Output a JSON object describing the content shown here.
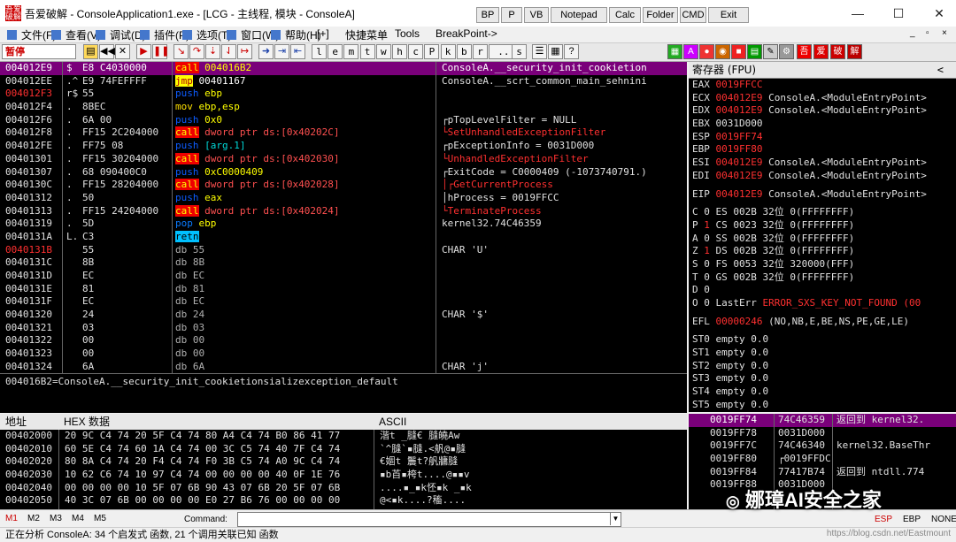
{
  "window": {
    "app_icon": "吾爱\n破解",
    "title": "吾爱破解 - ConsoleApplication1.exe - [LCG - 主线程, 模块 - ConsoleA]",
    "tool_buttons": [
      "BP",
      "P",
      "VB",
      "Notepad",
      "Calc",
      "Folder",
      "CMD",
      "Exit"
    ],
    "controls": {
      "min": "—",
      "max": "☐",
      "close": "✕"
    }
  },
  "menu": {
    "items": [
      "文件(F)",
      "查看(V)",
      "调试(D)",
      "插件(P)",
      "选项(T)",
      "窗口(W)",
      "帮助(H)",
      "[+]",
      "快捷菜单",
      "Tools",
      "BreakPoint->"
    ],
    "mdi": [
      "_",
      "▫",
      "×"
    ]
  },
  "toolbar": {
    "status": "暂停",
    "letters": [
      "l",
      "e",
      "m",
      "t",
      "w",
      "h",
      "c",
      "P",
      "k",
      "b",
      "r",
      "...",
      "s"
    ],
    "right_icons": [
      "吾",
      "爱",
      "破",
      "解"
    ],
    "a_label": "A"
  },
  "cpu": {
    "rows": [
      {
        "addr": "004012E9",
        "m": "$",
        "hex": "E8 C4030000",
        "op": "call",
        "args": "004016B2",
        "cmt": "ConsoleA.__security_init_cookietion",
        "sel": true
      },
      {
        "addr": "004012EE",
        "m": ".^",
        "hex": "E9 74FEFFFF",
        "op": "jmp",
        "args": "00401167",
        "cmt": "ConsoleA.__scrt_common_main_sehnini"
      },
      {
        "addr": "004012F3",
        "m": "r$",
        "hex": "55",
        "op": "push",
        "args": "ebp",
        "cmt": "",
        "red": true
      },
      {
        "addr": "004012F4",
        "m": ".",
        "hex": "8BEC",
        "op": "mov",
        "args": "ebp,esp",
        "cmt": ""
      },
      {
        "addr": "004012F6",
        "m": ".",
        "hex": "6A 00",
        "op": "push",
        "args": "0x0",
        "cmt": "┌pTopLevelFilter = NULL"
      },
      {
        "addr": "004012F8",
        "m": ".",
        "hex": "FF15 2C204000",
        "op": "call",
        "args": "dword ptr ds:[0x40202C]",
        "cmt": "└SetUnhandledExceptionFilter"
      },
      {
        "addr": "004012FE",
        "m": ".",
        "hex": "FF75 08",
        "op": "push",
        "args": "[arg.1]",
        "cmt": "┌pExceptionInfo = 0031D000"
      },
      {
        "addr": "00401301",
        "m": ".",
        "hex": "FF15 30204000",
        "op": "call",
        "args": "dword ptr ds:[0x402030]",
        "cmt": "└UnhandledExceptionFilter"
      },
      {
        "addr": "00401307",
        "m": ".",
        "hex": "68 090400C0",
        "op": "push",
        "args": "0xC0000409",
        "cmt": "┌ExitCode = C0000409 (-1073740791.)"
      },
      {
        "addr": "0040130C",
        "m": ".",
        "hex": "FF15 28204000",
        "op": "call",
        "args": "dword ptr ds:[0x402028]",
        "cmt": "│┌GetCurrentProcess"
      },
      {
        "addr": "00401312",
        "m": ".",
        "hex": "50",
        "op": "push",
        "args": "eax",
        "cmt": "│hProcess = 0019FFCC"
      },
      {
        "addr": "00401313",
        "m": ".",
        "hex": "FF15 24204000",
        "op": "call",
        "args": "dword ptr ds:[0x402024]",
        "cmt": "└TerminateProcess"
      },
      {
        "addr": "00401319",
        "m": ".",
        "hex": "5D",
        "op": "pop",
        "args": "ebp",
        "cmt": "kernel32.74C46359"
      },
      {
        "addr": "0040131A",
        "m": "L.",
        "hex": "C3",
        "op": "retn",
        "args": "",
        "cmt": ""
      },
      {
        "addr": "0040131B",
        "m": "",
        "hex": "55",
        "op": "db",
        "args": "55",
        "cmt": "CHAR 'U'",
        "red": true
      },
      {
        "addr": "0040131C",
        "m": "",
        "hex": "8B",
        "op": "db",
        "args": "8B",
        "cmt": ""
      },
      {
        "addr": "0040131D",
        "m": "",
        "hex": "EC",
        "op": "db",
        "args": "EC",
        "cmt": ""
      },
      {
        "addr": "0040131E",
        "m": "",
        "hex": "81",
        "op": "db",
        "args": "81",
        "cmt": ""
      },
      {
        "addr": "0040131F",
        "m": "",
        "hex": "EC",
        "op": "db",
        "args": "EC",
        "cmt": ""
      },
      {
        "addr": "00401320",
        "m": "",
        "hex": "24",
        "op": "db",
        "args": "24",
        "cmt": "CHAR '$'"
      },
      {
        "addr": "00401321",
        "m": "",
        "hex": "03",
        "op": "db",
        "args": "03",
        "cmt": ""
      },
      {
        "addr": "00401322",
        "m": "",
        "hex": "00",
        "op": "db",
        "args": "00",
        "cmt": ""
      },
      {
        "addr": "00401323",
        "m": "",
        "hex": "00",
        "op": "db",
        "args": "00",
        "cmt": ""
      },
      {
        "addr": "00401324",
        "m": "",
        "hex": "6A",
        "op": "db",
        "args": "6A",
        "cmt": "CHAR 'j'"
      }
    ],
    "info_line": "004016B2=ConsoleA.__security_init_cookietionsializexception_default"
  },
  "registers": {
    "header": "寄存器 (FPU)",
    "collapse": "<",
    "gpr": [
      {
        "n": "EAX",
        "v": "0019FFCC",
        "c": ""
      },
      {
        "n": "ECX",
        "v": "004012E9",
        "c": "ConsoleA.<ModuleEntryPoint>"
      },
      {
        "n": "EDX",
        "v": "004012E9",
        "c": "ConsoleA.<ModuleEntryPoint>"
      },
      {
        "n": "EBX",
        "v": "0031D000",
        "c": "",
        "white": true
      },
      {
        "n": "ESP",
        "v": "0019FF74",
        "c": ""
      },
      {
        "n": "EBP",
        "v": "0019FF80",
        "c": ""
      },
      {
        "n": "ESI",
        "v": "004012E9",
        "c": "ConsoleA.<ModuleEntryPoint>"
      },
      {
        "n": "EDI",
        "v": "004012E9",
        "c": "ConsoleA.<ModuleEntryPoint>"
      }
    ],
    "eip": {
      "n": "EIP",
      "v": "004012E9",
      "c": "ConsoleA.<ModuleEntryPoint>"
    },
    "flags": [
      {
        "f": "C",
        "b": "0",
        "s": "ES 002B 32位 0(FFFFFFFF)"
      },
      {
        "f": "P",
        "b": "1",
        "s": "CS 0023 32位 0(FFFFFFFF)",
        "red": true
      },
      {
        "f": "A",
        "b": "0",
        "s": "SS 002B 32位 0(FFFFFFFF)"
      },
      {
        "f": "Z",
        "b": "1",
        "s": "DS 002B 32位 0(FFFFFFFF)",
        "red": true
      },
      {
        "f": "S",
        "b": "0",
        "s": "FS 0053 32位 320000(FFF)"
      },
      {
        "f": "T",
        "b": "0",
        "s": "GS 002B 32位 0(FFFFFFFF)"
      },
      {
        "f": "D",
        "b": "0",
        "s": ""
      },
      {
        "f": "O",
        "b": "0",
        "s": "LastErr"
      }
    ],
    "lasterr": "ERROR_SXS_KEY_NOT_FOUND (00",
    "efl": {
      "n": "EFL",
      "v": "00000246",
      "c": "(NO,NB,E,BE,NS,PE,GE,LE)"
    },
    "fpu": [
      "ST0 empty 0.0",
      "ST1 empty 0.0",
      "ST2 empty 0.0",
      "ST3 empty 0.0",
      "ST4 empty 0.0",
      "ST5 empty 0.0"
    ]
  },
  "dump": {
    "headers": {
      "addr": "地址",
      "hex": "HEX 数据",
      "ascii": "ASCII"
    },
    "rows": [
      {
        "a": "00402000",
        "h": "20 9C C4 74 20 5F C4 74 80 A4 C4 74 B0 86 41 77",
        "s": "湝t _膖€ 膖皢Aw"
      },
      {
        "a": "00402010",
        "h": "60 5E C4 74 60 1A C4 74 00 3C C5 74 40 7F C4 74",
        "s": "`^膖`▪膖.<舤@▪膖"
      },
      {
        "a": "00402020",
        "h": "80 8A C4 74 20 F4 C4 74 F0 3B C5 74 A0 9C C4 74",
        "s": "€婟t 鬞t?舤牅膖"
      },
      {
        "a": "00402030",
        "h": "10 62 C6 74 10 97 C4 74 00 00 00 00 40 0F 1E 76",
        "s": "▪b苩▪桍t....@▪▪v"
      },
      {
        "a": "00402040",
        "h": "00 00 00 00 10 5F 07 6B 90 43 07 6B 20 5F 07 6B",
        "s": "....▪_▪k怌▪k _▪k"
      },
      {
        "a": "00402050",
        "h": "40 3C 07 6B 00 00 00 00 E0 27 B6 76 00 00 00 00",
        "s": "@<▪k....?稸...."
      }
    ]
  },
  "stack": {
    "rows": [
      {
        "a": "0019FF74",
        "v": "74C46359",
        "c": "返回到 kernel32.",
        "sel": true
      },
      {
        "a": "0019FF78",
        "v": "0031D000",
        "c": ""
      },
      {
        "a": "0019FF7C",
        "v": "74C46340",
        "c": "kernel32.BaseThr"
      },
      {
        "a": "0019FF80",
        "v": "┌0019FFDC",
        "c": ""
      },
      {
        "a": "0019FF84",
        "v": "77417B74",
        "c": "返回到 ntdll.774"
      },
      {
        "a": "0019FF88",
        "v": "0031D000",
        "c": ""
      }
    ]
  },
  "bottom": {
    "mtabs": [
      "M1",
      "M2",
      "M3",
      "M4",
      "M5"
    ],
    "command_label": "Command:",
    "reg_tabs": [
      "ESP",
      "EBP",
      "NONE"
    ],
    "status": "正在分析 ConsoleA: 34 个启发式 函数, 21 个调用关联已知 函数"
  },
  "watermark": {
    "text": "娜璋AI安全之家",
    "url": "https://blog.csdn.net/Eastmount"
  },
  "colors": {
    "selection": "#7a007a",
    "call": "#e00000",
    "push": "#0d5cff",
    "red": "#ff3030"
  }
}
